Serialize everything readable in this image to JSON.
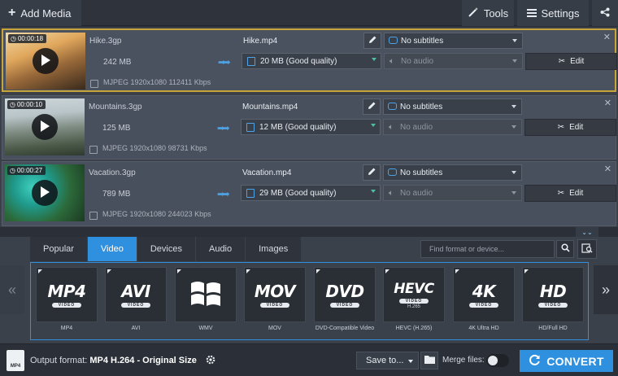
{
  "toolbar": {
    "add_media": "Add Media",
    "tools": "Tools",
    "settings": "Settings"
  },
  "files": [
    {
      "duration": "00:00:18",
      "source_name": "Hike.3gp",
      "source_size": "242 MB",
      "source_info": "MJPEG 1920x1080 112411 Kbps",
      "output_name": "Hike.mp4",
      "output_quality": "20 MB (Good quality)",
      "subtitles": "No subtitles",
      "audio": "No audio",
      "edit_label": "Edit",
      "selected": true
    },
    {
      "duration": "00:00:10",
      "source_name": "Mountains.3gp",
      "source_size": "125 MB",
      "source_info": "MJPEG 1920x1080 98731 Kbps",
      "output_name": "Mountains.mp4",
      "output_quality": "12 MB (Good quality)",
      "subtitles": "No subtitles",
      "audio": "No audio",
      "edit_label": "Edit",
      "selected": false
    },
    {
      "duration": "00:00:27",
      "source_name": "Vacation.3gp",
      "source_size": "789 MB",
      "source_info": "MJPEG 1920x1080 244023 Kbps",
      "output_name": "Vacation.mp4",
      "output_quality": "29 MB (Good quality)",
      "subtitles": "No subtitles",
      "audio": "No audio",
      "edit_label": "Edit",
      "selected": false
    }
  ],
  "tabs": [
    "Popular",
    "Video",
    "Devices",
    "Audio",
    "Images"
  ],
  "active_tab": "Video",
  "search": {
    "placeholder": "Find format or device..."
  },
  "formats": [
    {
      "logo": "MP4",
      "pill": "VIDEO",
      "caption": "MP4"
    },
    {
      "logo": "AVI",
      "pill": "VIDEO",
      "caption": "AVI"
    },
    {
      "logo": "",
      "pill": "",
      "caption": "WMV",
      "icon": "windows-logo-icon"
    },
    {
      "logo": "MOV",
      "pill": "VIDEO",
      "caption": "MOV"
    },
    {
      "logo": "DVD",
      "pill": "VIDEO",
      "caption": "DVD-Compatible Video"
    },
    {
      "logo": "HEVC",
      "pill": "VIDEO",
      "sub": "H.265",
      "caption": "HEVC (H.265)"
    },
    {
      "logo": "4K",
      "pill": "VIDEO",
      "caption": "4K Ultra HD"
    },
    {
      "logo": "HD",
      "pill": "VIDEO",
      "caption": "HD/Full HD"
    }
  ],
  "bottom": {
    "output_icon_text": "MP4",
    "output_prefix": "Output format:",
    "output_format": "MP4 H.264 - Original Size",
    "save_to": "Save to...",
    "merge_files": "Merge files:",
    "convert": "CONVERT"
  },
  "colors": {
    "accent": "#2f90e0",
    "selected_border": "#c7a53b"
  }
}
